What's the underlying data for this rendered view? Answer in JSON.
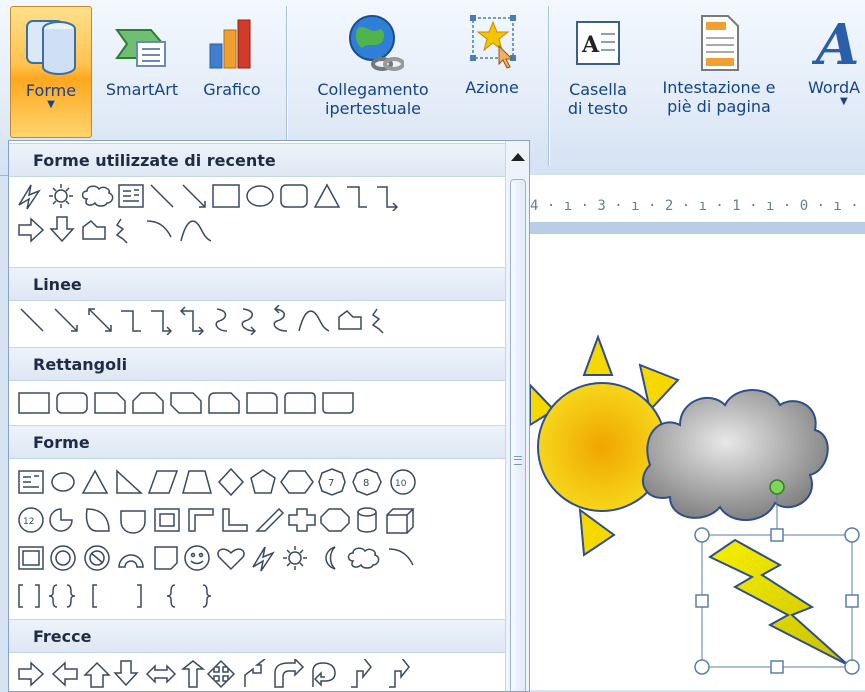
{
  "ribbon": {
    "forme_label": "Forme",
    "smartart_label": "SmartArt",
    "grafico_label": "Grafico",
    "collegamento_line1": "Collegamento",
    "collegamento_line2": "ipertestuale",
    "azione_label": "Azione",
    "casella_line1": "Casella",
    "casella_line2": "di testo",
    "intestazione_line1": "Intestazione e",
    "intestazione_line2": "piè di pagina",
    "wordart_label": "WordA"
  },
  "ruler": {
    "text": "4 · ı · 3 · ı · 2 · ı · 1 · ı · 0 · ı ·"
  },
  "panel": {
    "sections": [
      "Forme utilizzate di recente",
      "Linee",
      "Rettangoli",
      "Forme",
      "Frecce"
    ]
  },
  "colors": {
    "accent": "#ffc14d",
    "header_text": "#15428b",
    "sun": "#f5d800",
    "cloud": "#8c8c8c"
  }
}
